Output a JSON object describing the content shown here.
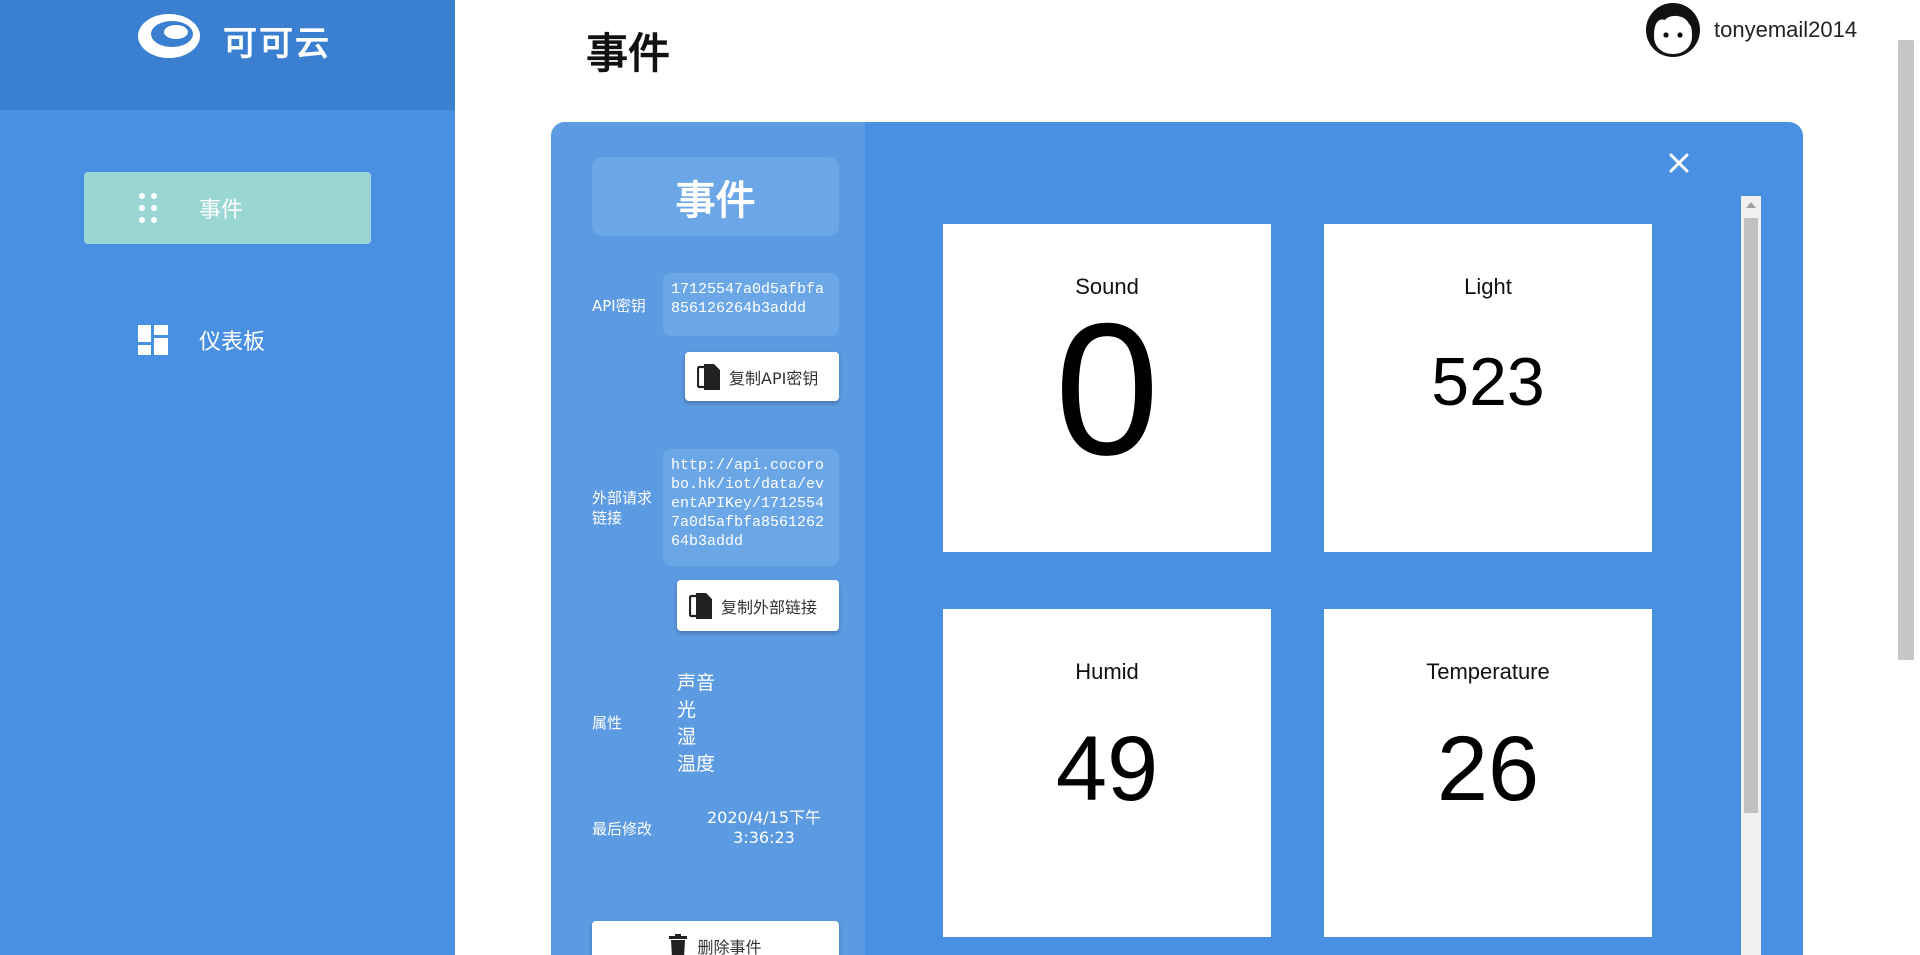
{
  "brand": {
    "name": "可可云"
  },
  "sidebar": {
    "items": [
      {
        "label": "事件"
      },
      {
        "label": "仪表板"
      }
    ]
  },
  "header": {
    "title": "事件",
    "username": "tonyemail2014"
  },
  "modal": {
    "title": "事件",
    "api_key_label": "API密钥",
    "api_key_value": "17125547a0d5afbfa856126264b3addd",
    "copy_api_key_button": "复制API密钥",
    "external_link_label": "外部请求链接",
    "external_link_value": "http://api.cocorobo.hk/iot/data/eventAPIKey/17125547a0d5afbfa856126264b3addd",
    "copy_external_link_button": "复制外部链接",
    "attributes_label": "属性",
    "attributes": [
      "声音",
      "光",
      "湿",
      "温度"
    ],
    "last_modified_label": "最后修改",
    "last_modified_value": "2020/4/15下午3:36:23",
    "delete_button": "删除事件"
  },
  "cards": [
    {
      "title": "Sound",
      "value": "0"
    },
    {
      "title": "Light",
      "value": "523"
    },
    {
      "title": "Humid",
      "value": "49"
    },
    {
      "title": "Temperature",
      "value": "26"
    }
  ]
}
